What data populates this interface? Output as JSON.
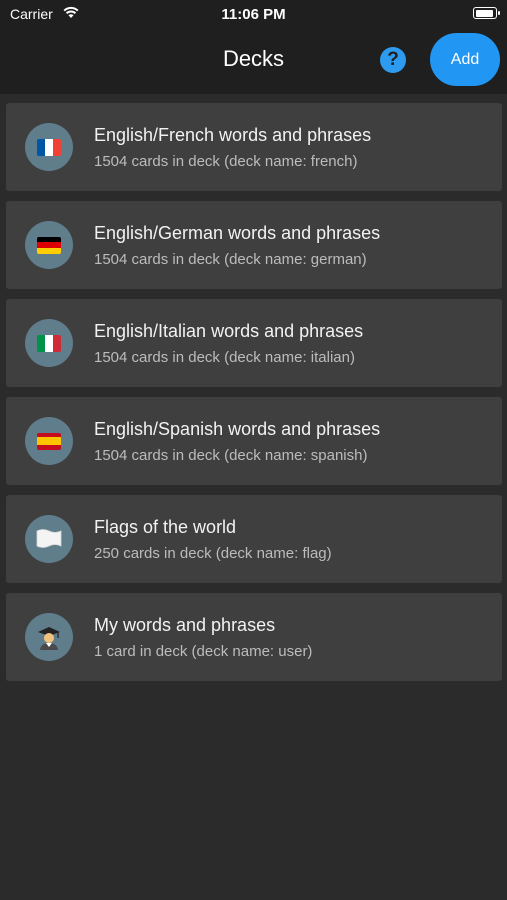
{
  "status_bar": {
    "carrier": "Carrier",
    "time": "11:06 PM",
    "battery_level": 0.9
  },
  "nav": {
    "title": "Decks",
    "help_label": "?",
    "add_label": "Add"
  },
  "decks": [
    {
      "title": "English/French words and phrases",
      "subtitle": "1504 cards in deck (deck name: french)",
      "icon": "french-flag-icon"
    },
    {
      "title": "English/German words and phrases",
      "subtitle": "1504 cards in deck (deck name: german)",
      "icon": "german-flag-icon"
    },
    {
      "title": "English/Italian words and phrases",
      "subtitle": "1504 cards in deck (deck name: italian)",
      "icon": "italian-flag-icon"
    },
    {
      "title": "English/Spanish words and phrases",
      "subtitle": "1504 cards in deck (deck name: spanish)",
      "icon": "spanish-flag-icon"
    },
    {
      "title": "Flags of the world",
      "subtitle": "250 cards in deck (deck name: flag)",
      "icon": "white-flag-icon"
    },
    {
      "title": "My words and phrases",
      "subtitle": "1 card in deck (deck name: user)",
      "icon": "student-icon"
    }
  ],
  "colors": {
    "accent": "#2196f3",
    "avatar_bg": "#607d8b",
    "card_bg": "#3f3f3f",
    "background": "#2b2b2b"
  }
}
